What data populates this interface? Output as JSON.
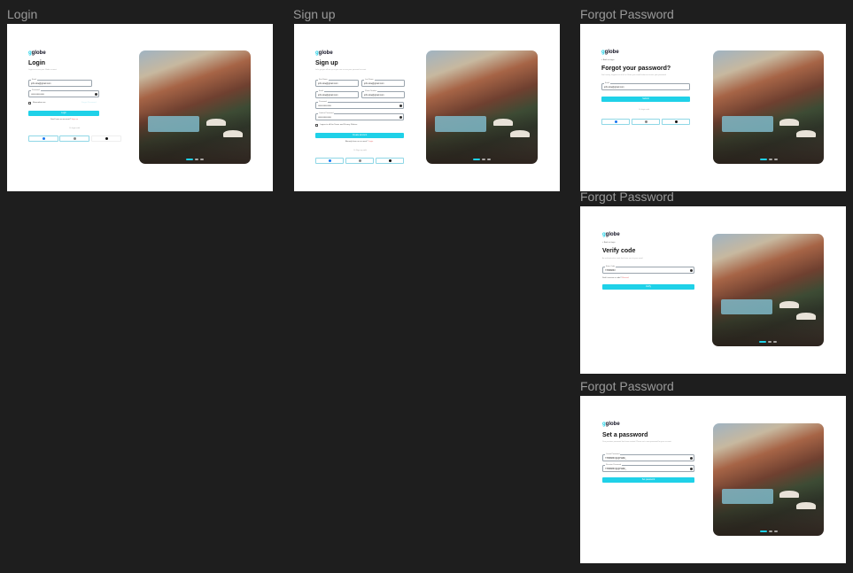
{
  "frames": {
    "login": {
      "label": "Login",
      "logo": "globe",
      "logo_prefix": "g",
      "title": "Login",
      "subtitle": "Login to access your Globe account",
      "email_label": "Email",
      "email_value": "john.doe@gmail.com",
      "password_label": "Password",
      "password_value": "••••••••••••••••••",
      "remember": "Remember me",
      "forgot": "Forgot Password",
      "login_button": "Login",
      "no_account": "Don't have an account?",
      "signup_link": "Sign up",
      "or_login": "Or login with"
    },
    "signup": {
      "label": "Sign up",
      "logo": "globe",
      "logo_prefix": "g",
      "title": "Sign up",
      "subtitle": "Let's get you all set up so you can access your personal account.",
      "first_name_label": "First Name",
      "first_name_value": "john.doe@gmail.com",
      "last_name_label": "Last Name",
      "last_name_value": "john.doe@gmail.com",
      "email_label": "Email",
      "email_value": "john.doe@gmail.com",
      "phone_label": "Phone Number",
      "phone_value": "john.doe@gmail.com",
      "password_label": "Password",
      "password_value": "••••••••••••••••••",
      "confirm_label": "Confirm Password",
      "confirm_value": "••••••••••••••••••",
      "agree": "I agree to all the Terms and Privacy Policies",
      "create_button": "Create account",
      "have_account": "Already have an account?",
      "login_link": "Login",
      "or_signup": "Or Sign up with"
    },
    "forgot": {
      "label": "Forgot Password",
      "logo": "globe",
      "logo_prefix": "g",
      "back": "< Back to login",
      "title": "Forgot your password?",
      "subtitle": "Don't worry, happens to all of us. Enter your email below to recover your password",
      "email_label": "Email",
      "email_value": "john.doe@gmail.com",
      "submit_button": "Submit",
      "or_login": "Or login with"
    },
    "verify": {
      "label": "Forgot Password",
      "logo": "globe",
      "logo_prefix": "g",
      "back": "< Back to login",
      "title": "Verify code",
      "subtitle": "An authentication code has been sent to your email.",
      "code_label": "Enter Code",
      "code_value": "7789BM6X",
      "resend_prompt": "Didn't receive a code?",
      "resend_link": "Resend",
      "verify_button": "Verify"
    },
    "setpw": {
      "label": "Forgot Password",
      "logo": "globe",
      "logo_prefix": "g",
      "title": "Set a password",
      "subtitle": "Your previous password has been reseted. Please set a new password for your account.",
      "create_label": "Create Password",
      "create_value": "7789BM6X@@H&$K_",
      "reenter_label": "Re-enter Password",
      "reenter_value": "7789BM6X@@H&$K_",
      "set_button": "Set password"
    }
  },
  "colors": {
    "accent": "#1fd1e8",
    "canvas": "#1e1e1e",
    "frame": "#ffffff",
    "label": "#9a9a9a"
  },
  "icons": [
    "facebook-icon",
    "google-icon",
    "apple-icon",
    "eye-icon"
  ]
}
